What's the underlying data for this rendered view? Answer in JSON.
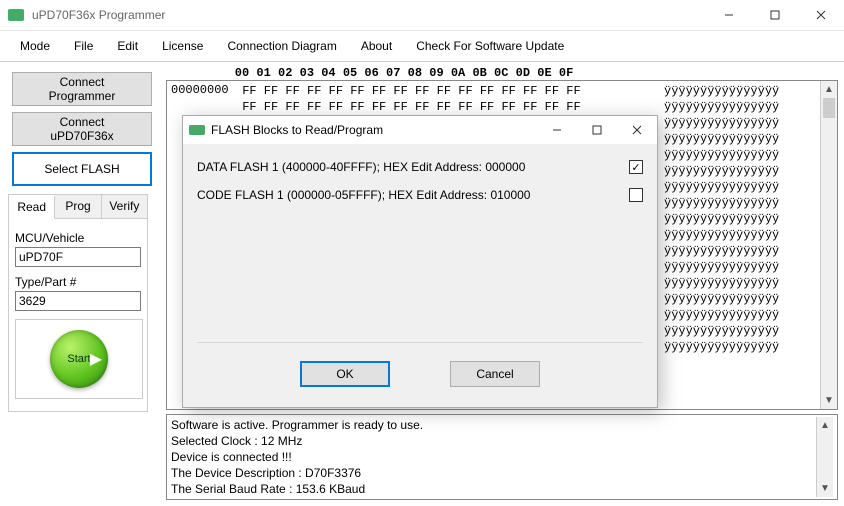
{
  "window": {
    "title": "uPD70F36x Programmer"
  },
  "menu": [
    "Mode",
    "File",
    "Edit",
    "License",
    "Connection Diagram",
    "About",
    "Check For Software Update"
  ],
  "sidebar": {
    "connect_programmer": "Connect\nProgrammer",
    "connect_device": "Connect\nuPD70F36x",
    "select_flash": "Select FLASH"
  },
  "tabs": [
    "Read",
    "Prog",
    "Verify"
  ],
  "fields": {
    "mcu_label": "MCU/Vehicle",
    "mcu_value": "uPD70F",
    "type_label": "Type/Part #",
    "type_value": "3629"
  },
  "start_label": "Start",
  "hex": {
    "header": "         00 01 02 03 04 05 06 07 08 09 0A 0B 0C 0D 0E 0F",
    "gutter_first": "00000000",
    "row_hex": " FF FF FF FF FF FF FF FF FF FF FF FF FF FF FF FF ",
    "row_ascii": "ÿÿÿÿÿÿÿÿÿÿÿÿÿÿÿÿ",
    "row_count": 17
  },
  "status": [
    "Software is active. Programmer is ready to use.",
    "Selected Clock : 12 MHz",
    "Device is connected !!!",
    "The Device Description : D70F3376",
    "The Serial Baud Rate : 153.6 KBaud"
  ],
  "dialog": {
    "title": "FLASH Blocks to Read/Program",
    "rows": [
      {
        "label": "DATA FLASH 1 (400000-40FFFF); HEX Edit Address: 000000",
        "checked": true
      },
      {
        "label": "CODE FLASH 1 (000000-05FFFF); HEX Edit Address: 010000",
        "checked": false
      }
    ],
    "ok": "OK",
    "cancel": "Cancel"
  }
}
